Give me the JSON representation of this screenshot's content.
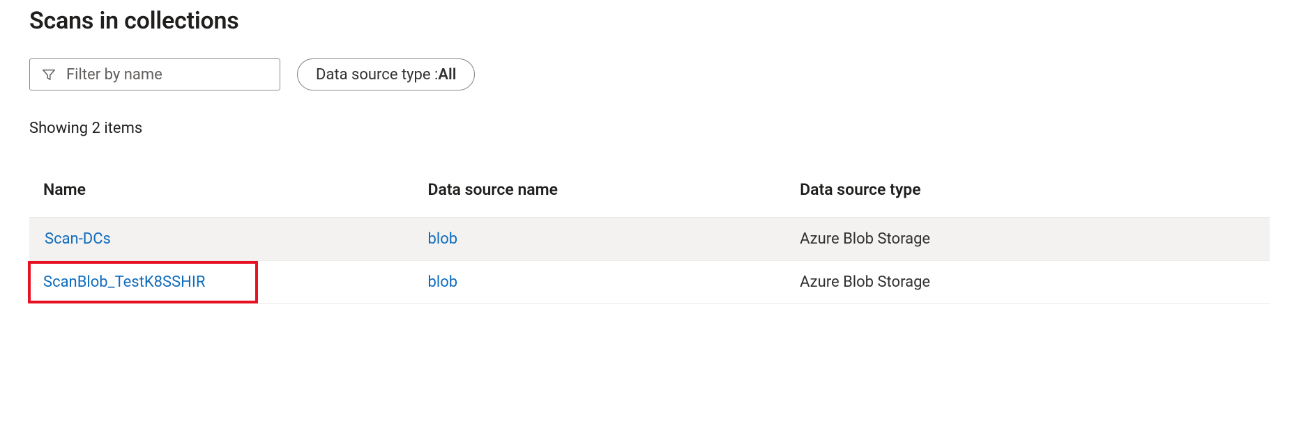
{
  "page": {
    "title": "Scans in collections",
    "status": "Showing 2 items"
  },
  "filter": {
    "placeholder": "Filter by name"
  },
  "dropdown": {
    "label": "Data source type : ",
    "value": "All"
  },
  "table": {
    "columns": {
      "name": "Name",
      "source": "Data source name",
      "type": "Data source type"
    },
    "rows": [
      {
        "name": "Scan-DCs",
        "source": "blob",
        "type": "Azure Blob Storage",
        "shaded": true,
        "highlighted": false
      },
      {
        "name": "ScanBlob_TestK8SSHIR",
        "source": "blob",
        "type": "Azure Blob Storage",
        "shaded": false,
        "highlighted": true
      }
    ]
  }
}
